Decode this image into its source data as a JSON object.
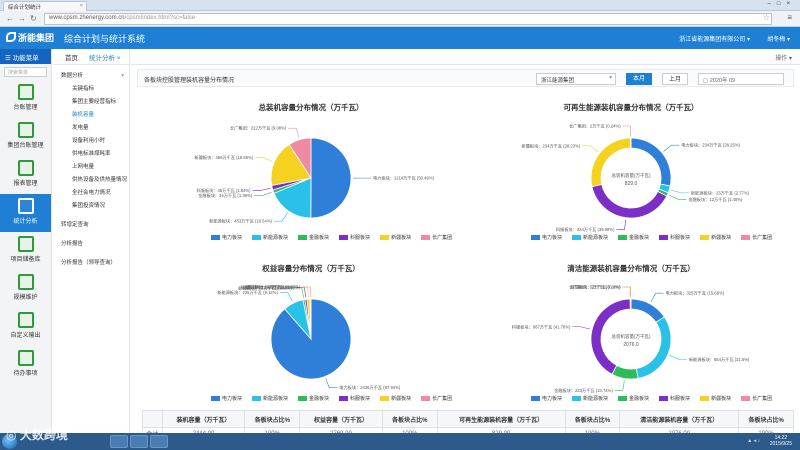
{
  "browser": {
    "tab_title": "综合计划统计",
    "url_host": "www.cpsm.zhenergy.com.cn",
    "url_path": "/cpsm/index.html?sc=false"
  },
  "header": {
    "logo": "浙能集团",
    "system_title": "综合计划与统计系统",
    "company": "浙江省能源集团有限公司",
    "user": "胡冬梅"
  },
  "sidebar": {
    "title": "功能菜单",
    "search_placeholder": "搜索菜单",
    "items": [
      {
        "label": "台账管理",
        "icon": "ledger-icon"
      },
      {
        "label": "集团台账管理",
        "icon": "group-ledger-icon"
      },
      {
        "label": "报表管理",
        "icon": "report-icon"
      },
      {
        "label": "统计分析",
        "icon": "analysis-icon"
      },
      {
        "label": "项目储备库",
        "icon": "project-icon"
      },
      {
        "label": "规模维护",
        "icon": "maintenance-icon"
      },
      {
        "label": "自定义输出",
        "icon": "export-icon"
      },
      {
        "label": "待办事项",
        "icon": "todo-icon"
      }
    ]
  },
  "tree": {
    "items": [
      {
        "label": "数据分析",
        "level": 0,
        "expanded": true
      },
      {
        "label": "关键指标",
        "level": 1
      },
      {
        "label": "集团主要经营指标",
        "level": 1
      },
      {
        "label": "装机容量",
        "level": 1,
        "selected": true
      },
      {
        "label": "发电量",
        "level": 1
      },
      {
        "label": "设备利用小时",
        "level": 1
      },
      {
        "label": "供电标准煤耗率",
        "level": 1
      },
      {
        "label": "上网电量",
        "level": 1
      },
      {
        "label": "供热设备及供热量情况",
        "level": 1
      },
      {
        "label": "全社会电力情况",
        "level": 1
      },
      {
        "label": "集团投资情况",
        "level": 1
      },
      {
        "label": "转增定查询",
        "level": 0
      },
      {
        "label": "分析报告",
        "level": 0
      },
      {
        "label": "分析报告（领导查询）",
        "level": 0
      }
    ]
  },
  "tabs": {
    "home": "首页",
    "current": "统计分析",
    "ops": "操作"
  },
  "filter": {
    "title": "各板块控股管理装机容量分布情况",
    "select": "浙江能源集团",
    "btn_month": "本月",
    "btn_year": "上月",
    "date": "2020年 09"
  },
  "colors": {
    "电力板块": "#2f7fd9",
    "新能源板块": "#29c1e8",
    "金融板块": "#2fbb5a",
    "科服板块": "#7b2fc7",
    "新疆板块": "#f5d21f",
    "长广集团": "#f08aa2"
  },
  "chart_data": [
    {
      "type": "pie",
      "title": "总装机容量分布情况（万千瓦）",
      "slices": [
        {
          "name": "电力板块",
          "value": 1214,
          "label": "电力板块：1214万千瓦 (50.49%)"
        },
        {
          "name": "新能源板块",
          "value": 453,
          "label": "新能源板块：453万千瓦 (18.54%)"
        },
        {
          "name": "金融板块",
          "value": 34,
          "label": "金融板块：34万千瓦 (1.39%)"
        },
        {
          "name": "科服板块",
          "value": 45,
          "label": "科服板块：45万千瓦 (1.84%)"
        },
        {
          "name": "新疆板块",
          "value": 456,
          "label": "新疆板块：456万千瓦 (18.66%)"
        },
        {
          "name": "长广集团",
          "value": 222,
          "label": "长广集团：222万千瓦 (9.08%)"
        }
      ],
      "legend": [
        "电力板块",
        "新能源板块",
        "金融板块",
        "科服板块",
        "新疆板块",
        "长广集团"
      ]
    },
    {
      "type": "pie",
      "donut": true,
      "title": "可再生能源装机容量分布情况（万千瓦）",
      "center_label": "总装机容量(万千瓦)",
      "center_value": "829.0",
      "slices": [
        {
          "name": "电力板块",
          "value": 234,
          "label": "电力板块：234万千瓦 (28.25%)"
        },
        {
          "name": "新能源板块",
          "value": 23,
          "label": "新能源板块：23万千瓦 (2.77%)"
        },
        {
          "name": "金融板块",
          "value": 12,
          "label": "金融板块：12万千瓦 (1.45%)"
        },
        {
          "name": "科服板块",
          "value": 324,
          "label": "科服板块：324万千瓦 (39.08%)"
        },
        {
          "name": "新疆板块",
          "value": 234,
          "label": "新疆板块：234万千瓦 (28.23%)"
        },
        {
          "name": "长广集团",
          "value": 2,
          "label": "长广集团：2万千瓦 (0.24%)"
        }
      ],
      "legend": [
        "电力板块",
        "新能源板块",
        "金融板块",
        "科服板块",
        "新疆板块",
        "长广集团"
      ]
    },
    {
      "type": "pie",
      "title": "权益容量分布情况（万千瓦）",
      "slices": [
        {
          "name": "电力板块",
          "value": 2435,
          "label": "电力板块：2435万千瓦 (87.94%)"
        },
        {
          "name": "新能源板块",
          "value": 225,
          "label": "新能源板块：225万千瓦 (8.12%)"
        },
        {
          "name": "金融板块",
          "value": 22,
          "label": "金融板块：22万千瓦 (0.80%)"
        },
        {
          "name": "科服板块",
          "value": 23,
          "label": "科服板块：23万千瓦 (0.81%)"
        },
        {
          "name": "新疆板块",
          "value": 32,
          "label": "新疆板块：32万千瓦 (1.16%)"
        },
        {
          "name": "长广集团",
          "value": 12,
          "label": "长广集团：12万千瓦 (0.43%)"
        }
      ],
      "legend": [
        "电力板块",
        "新能源板块",
        "金融板块",
        "科服板块",
        "新疆板块",
        "长广集团"
      ]
    },
    {
      "type": "pie",
      "donut": true,
      "title": "清洁能源装机容量分布情况（万千瓦）",
      "center_label": "总装机容量(万千瓦)",
      "center_value": "2076.0",
      "slices": [
        {
          "name": "电力板块",
          "value": 325,
          "label": "电力板块：325万千瓦 (15.66%)"
        },
        {
          "name": "新能源板块",
          "value": 654,
          "label": "新能源板块：654万千瓦 (31.5%)"
        },
        {
          "name": "金融板块",
          "value": 223,
          "label": "金融板块：223万千瓦 (10.74%)"
        },
        {
          "name": "科服板块",
          "value": 867,
          "label": "科服板块：867万千瓦 (41.76%)"
        },
        {
          "name": "新疆板块",
          "value": 2,
          "label": "新疆板块：2万千瓦 (0.1%)"
        },
        {
          "name": "长广集团",
          "value": 5,
          "label": "长广集团：5万千瓦 (0.24%)"
        }
      ],
      "legend": [
        "电力板块",
        "新能源板块",
        "金融板块",
        "科服板块",
        "新疆板块",
        "长广集团"
      ]
    }
  ],
  "table": {
    "headers": [
      "",
      "装机容量（万千瓦）",
      "各板块占比%",
      "权益容量（万千瓦）",
      "各板块占比%",
      "可再生能源装机容量（万千瓦）",
      "各板块占比%",
      "清洁能源装机容量（万千瓦）",
      "各板块占比%"
    ],
    "row1": [
      "合计",
      "2444.00",
      "100%",
      "2769.00",
      "100%",
      "829.00",
      "100%",
      "2076.00",
      "100%"
    ]
  },
  "taskbar": {
    "time": "14:22",
    "date": "2015/9/25",
    "watermark": "大数跨境"
  }
}
